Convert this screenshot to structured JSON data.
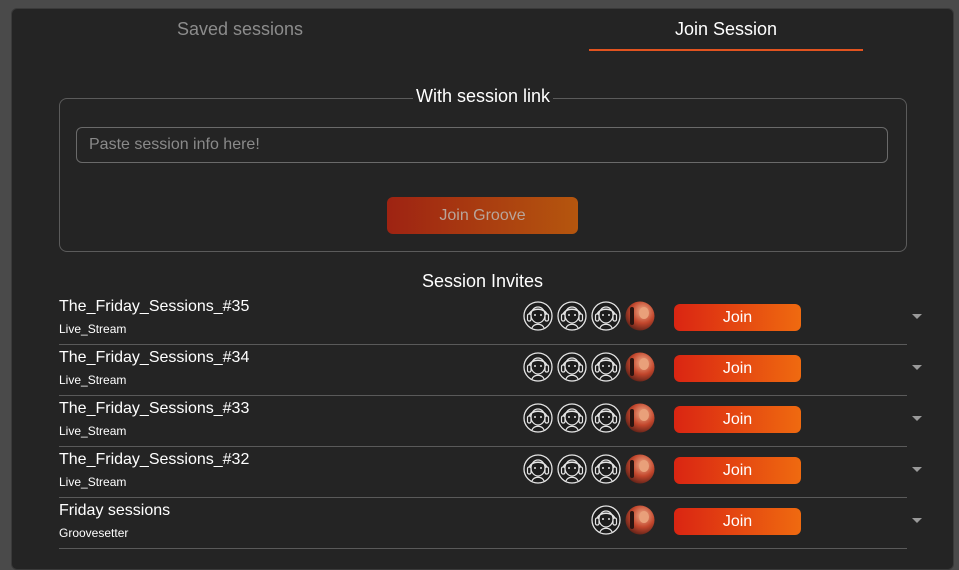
{
  "tabs": {
    "saved_label": "Saved sessions",
    "join_label": "Join Session",
    "active": "join",
    "accent": "#e2531f"
  },
  "link_section": {
    "legend": "With session link",
    "input_placeholder": "Paste session info here!",
    "input_value": "",
    "join_button_label": "Join Groove"
  },
  "invites": {
    "title": "Session Invites",
    "join_label": "Join",
    "items": [
      {
        "name": "The_Friday_Sessions_#35",
        "subtitle": "Live_Stream",
        "avatars": [
          "headphone-avatar-icon",
          "headphone-avatar-icon",
          "headphone-avatar-icon",
          "user-photo-avatar"
        ]
      },
      {
        "name": "The_Friday_Sessions_#34",
        "subtitle": "Live_Stream",
        "avatars": [
          "headphone-avatar-icon",
          "headphone-avatar-icon",
          "headphone-avatar-icon",
          "user-photo-avatar"
        ]
      },
      {
        "name": "The_Friday_Sessions_#33",
        "subtitle": "Live_Stream",
        "avatars": [
          "headphone-avatar-icon",
          "headphone-avatar-icon",
          "headphone-avatar-icon",
          "user-photo-avatar"
        ]
      },
      {
        "name": "The_Friday_Sessions_#32",
        "subtitle": "Live_Stream",
        "avatars": [
          "headphone-avatar-icon",
          "headphone-avatar-icon",
          "headphone-avatar-icon",
          "user-photo-avatar"
        ]
      },
      {
        "name": "Friday sessions",
        "subtitle": "Groovesetter",
        "avatars": [
          "headphone-avatar-icon",
          "user-photo-avatar"
        ]
      }
    ]
  }
}
